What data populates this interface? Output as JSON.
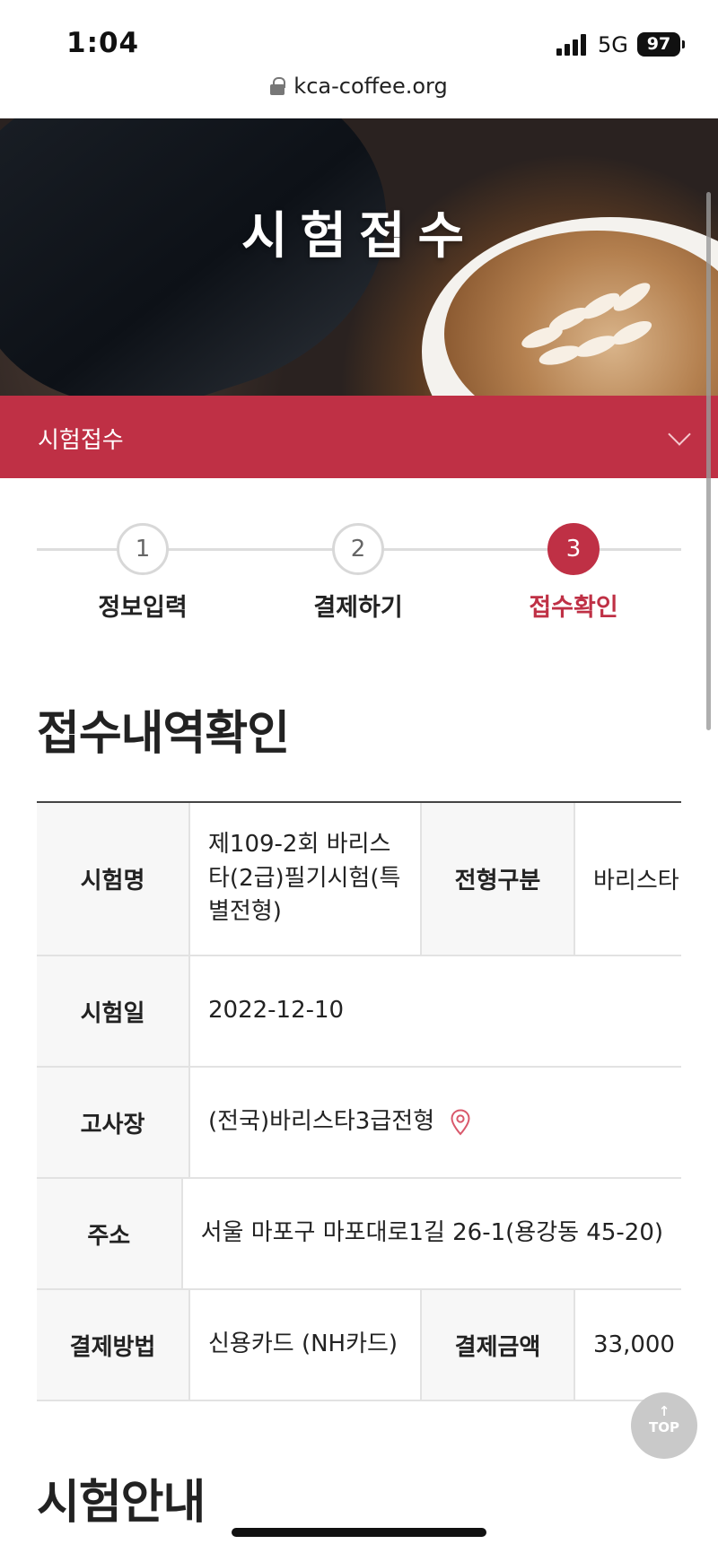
{
  "status_bar": {
    "time": "1:04",
    "network": "5G",
    "battery": "97"
  },
  "browser": {
    "url": "kca-coffee.org"
  },
  "hero": {
    "title": "시험접수"
  },
  "menu": {
    "label": "시험접수"
  },
  "steps": [
    {
      "number": "1",
      "label": "정보입력",
      "active": false
    },
    {
      "number": "2",
      "label": "결제하기",
      "active": false
    },
    {
      "number": "3",
      "label": "접수확인",
      "active": true
    }
  ],
  "section_title": "접수내역확인",
  "table": {
    "exam_name": {
      "label": "시험명",
      "value": "제109-2회 바리스타(2급)필기시험(특별전형)"
    },
    "selection_type": {
      "label": "전형구분",
      "value": "바리스타"
    },
    "exam_date": {
      "label": "시험일",
      "value": "2022-12-10"
    },
    "venue": {
      "label": "고사장",
      "value": "(전국)바리스타3급전형"
    },
    "address": {
      "label": "주소",
      "value": "서울 마포구 마포대로1길 26-1(용강동 45-20)"
    },
    "payment_method": {
      "label": "결제방법",
      "value": "신용카드 (NH카드)"
    },
    "payment_amount": {
      "label": "결제금액",
      "value": "33,000"
    }
  },
  "next_section_title": "시험안내",
  "top_button": {
    "arrow": "↑",
    "label": "TOP"
  },
  "colors": {
    "accent": "#bf3045",
    "header_cell": "#f7f7f7",
    "border": "#e2e2e2"
  }
}
